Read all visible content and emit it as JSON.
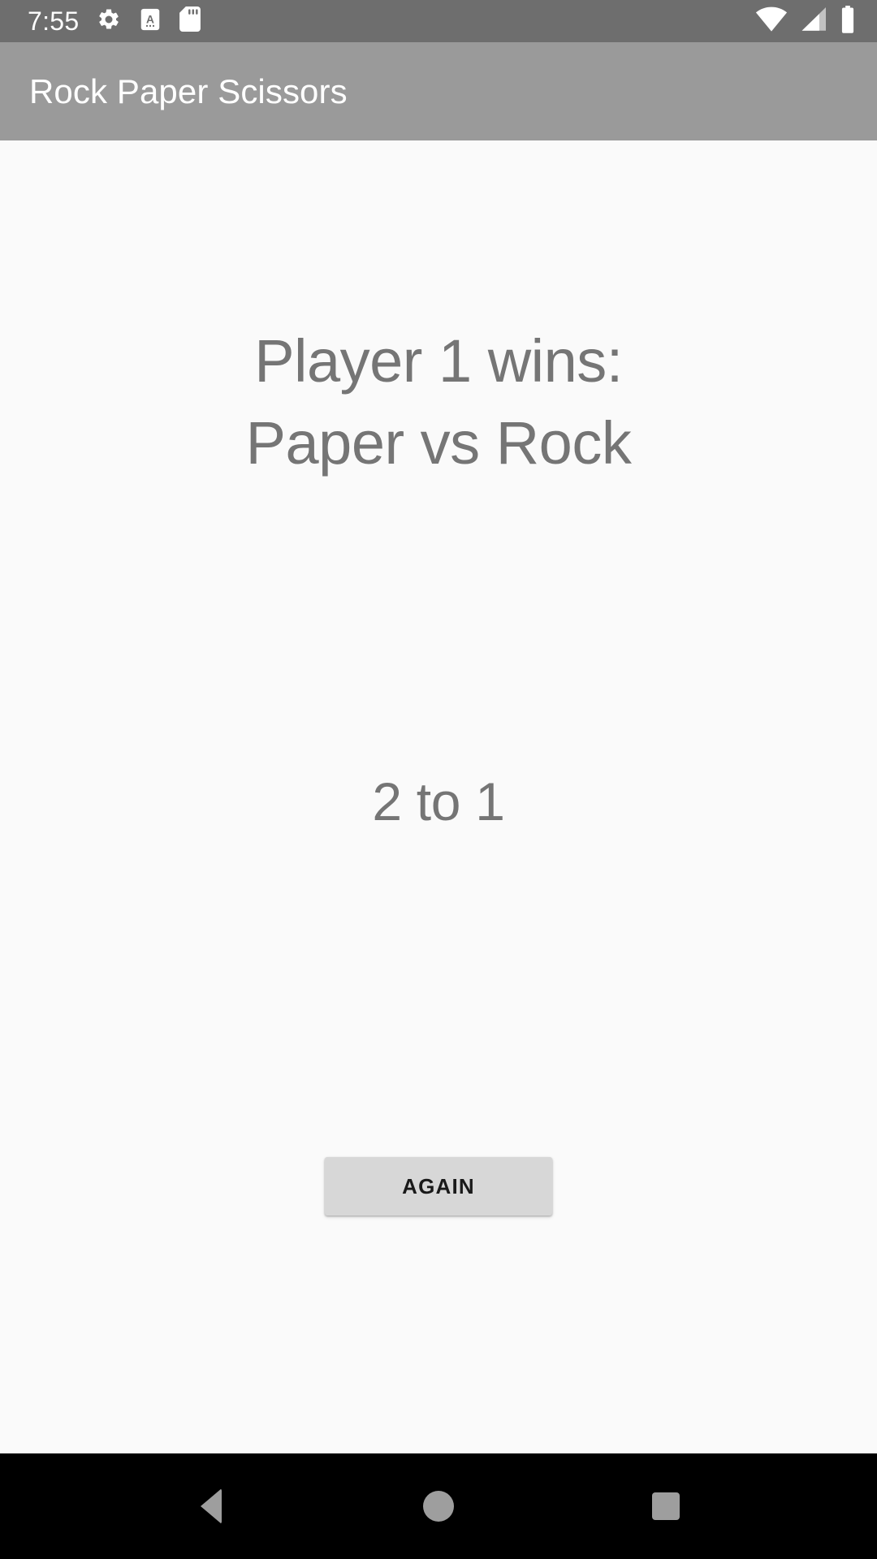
{
  "status_bar": {
    "time": "7:55",
    "left_icons": [
      "gear-icon",
      "document-a-icon",
      "sd-card-icon"
    ],
    "right_icons": [
      "wifi-icon",
      "cellular-signal-icon",
      "battery-icon"
    ],
    "background_color": "#6e6e6e",
    "foreground_color": "#ffffff"
  },
  "app_bar": {
    "title": "Rock Paper Scissors",
    "background_color": "#9a9a9a",
    "title_color": "#ffffff"
  },
  "main": {
    "result": "Player 1 wins:\nPaper vs Rock",
    "score": "2 to 1",
    "text_color": "#757575",
    "background_color": "#fafafa",
    "again_button_label": "AGAIN",
    "again_button_color": "#d7d7d7"
  },
  "nav_bar": {
    "background_color": "#000000",
    "icon_color": "#9e9e9e",
    "buttons": [
      "back-button",
      "home-button",
      "recents-button"
    ]
  }
}
